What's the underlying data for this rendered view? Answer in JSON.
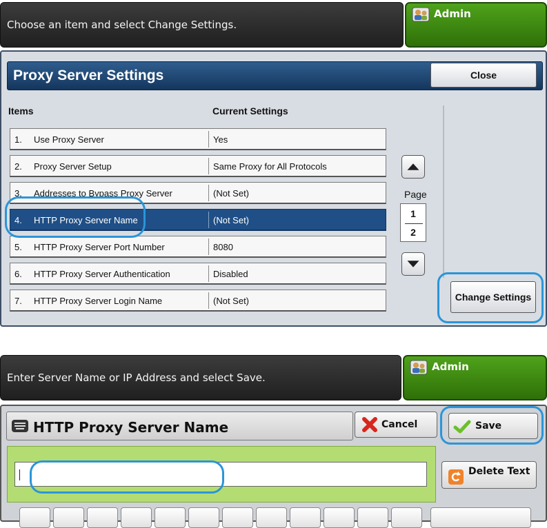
{
  "top": {
    "message": "Choose an item and select Change Settings.",
    "admin_label": "Admin",
    "title": "Proxy Server Settings",
    "close_label": "Close",
    "col_items": "Items",
    "col_settings": "Current Settings",
    "rows": [
      {
        "num": "1.",
        "name": "Use Proxy Server",
        "value": "Yes"
      },
      {
        "num": "2.",
        "name": "Proxy Server Setup",
        "value": "Same Proxy for All Protocols"
      },
      {
        "num": "3.",
        "name": "Addresses to Bypass Proxy Server",
        "value": "(Not Set)"
      },
      {
        "num": "4.",
        "name": "HTTP Proxy Server Name",
        "value": "(Not Set)"
      },
      {
        "num": "5.",
        "name": "HTTP Proxy Server Port Number",
        "value": "8080"
      },
      {
        "num": "6.",
        "name": "HTTP Proxy Server Authentication",
        "value": "Disabled"
      },
      {
        "num": "7.",
        "name": "HTTP Proxy Server Login Name",
        "value": "(Not Set)"
      }
    ],
    "selected_row": 4,
    "page_label": "Page",
    "page_current": "1",
    "page_total": "2",
    "change_settings_label": "Change Settings"
  },
  "bottom": {
    "message": "Enter Server Name or IP Address and select Save.",
    "admin_label": "Admin",
    "title": "HTTP Proxy Server Name",
    "cancel_label": "Cancel",
    "save_label": "Save",
    "delete_text_label": "Delete Text",
    "input_value": ""
  },
  "colors": {
    "accent_highlight": "#2b95d8",
    "title_blue": "#1f4f86",
    "admin_green": "#3f8a12",
    "input_green": "#b3dd72"
  },
  "icons": {
    "admin": "admin-user-icon",
    "keyboard": "keyboard-icon",
    "cancel": "red-x-icon",
    "save": "green-check-icon",
    "delete_text": "orange-undo-icon",
    "scroll_up": "triangle-up-icon",
    "scroll_down": "triangle-down-icon"
  }
}
